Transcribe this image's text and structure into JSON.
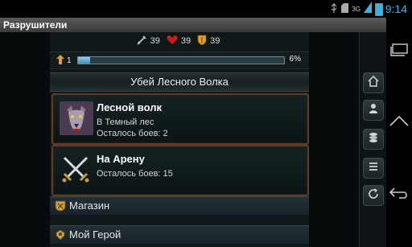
{
  "status_bar": {
    "network": "3G",
    "time": "9:14",
    "icons": [
      "usb-icon",
      "sd-card-icon",
      "network-3g-icon",
      "signal-icon",
      "battery-icon"
    ]
  },
  "app": {
    "title": "Разрушители"
  },
  "stats": {
    "attack": "39",
    "health": "39",
    "defense": "39"
  },
  "level": {
    "value": "1",
    "progress_pct": "6%",
    "progress_fraction": 0.06
  },
  "quest": {
    "header": "Убей Лесного Волка",
    "cards": [
      {
        "title": "Лесной волк",
        "lines": [
          "В Темный лес",
          "Осталось боев: 2"
        ],
        "icon": "wolf-icon"
      },
      {
        "title": "На Арену",
        "lines": [
          "Осталось боев: 15"
        ],
        "icon": "crossed-swords-icon"
      }
    ]
  },
  "menu": [
    {
      "label": "Магазин",
      "icon": "shop-icon"
    },
    {
      "label": "Мой Герой",
      "icon": "hero-icon"
    }
  ],
  "side_panel": [
    "home-icon",
    "character-icon",
    "coins-icon",
    "list-icon",
    "refresh-icon"
  ],
  "nav_bar": [
    "recent-apps-icon",
    "home-icon",
    "back-icon"
  ],
  "colors": {
    "status_accent": "#33b5e5",
    "card_border": "#5a3e2a",
    "bar_fill": "#3f8ec0"
  }
}
